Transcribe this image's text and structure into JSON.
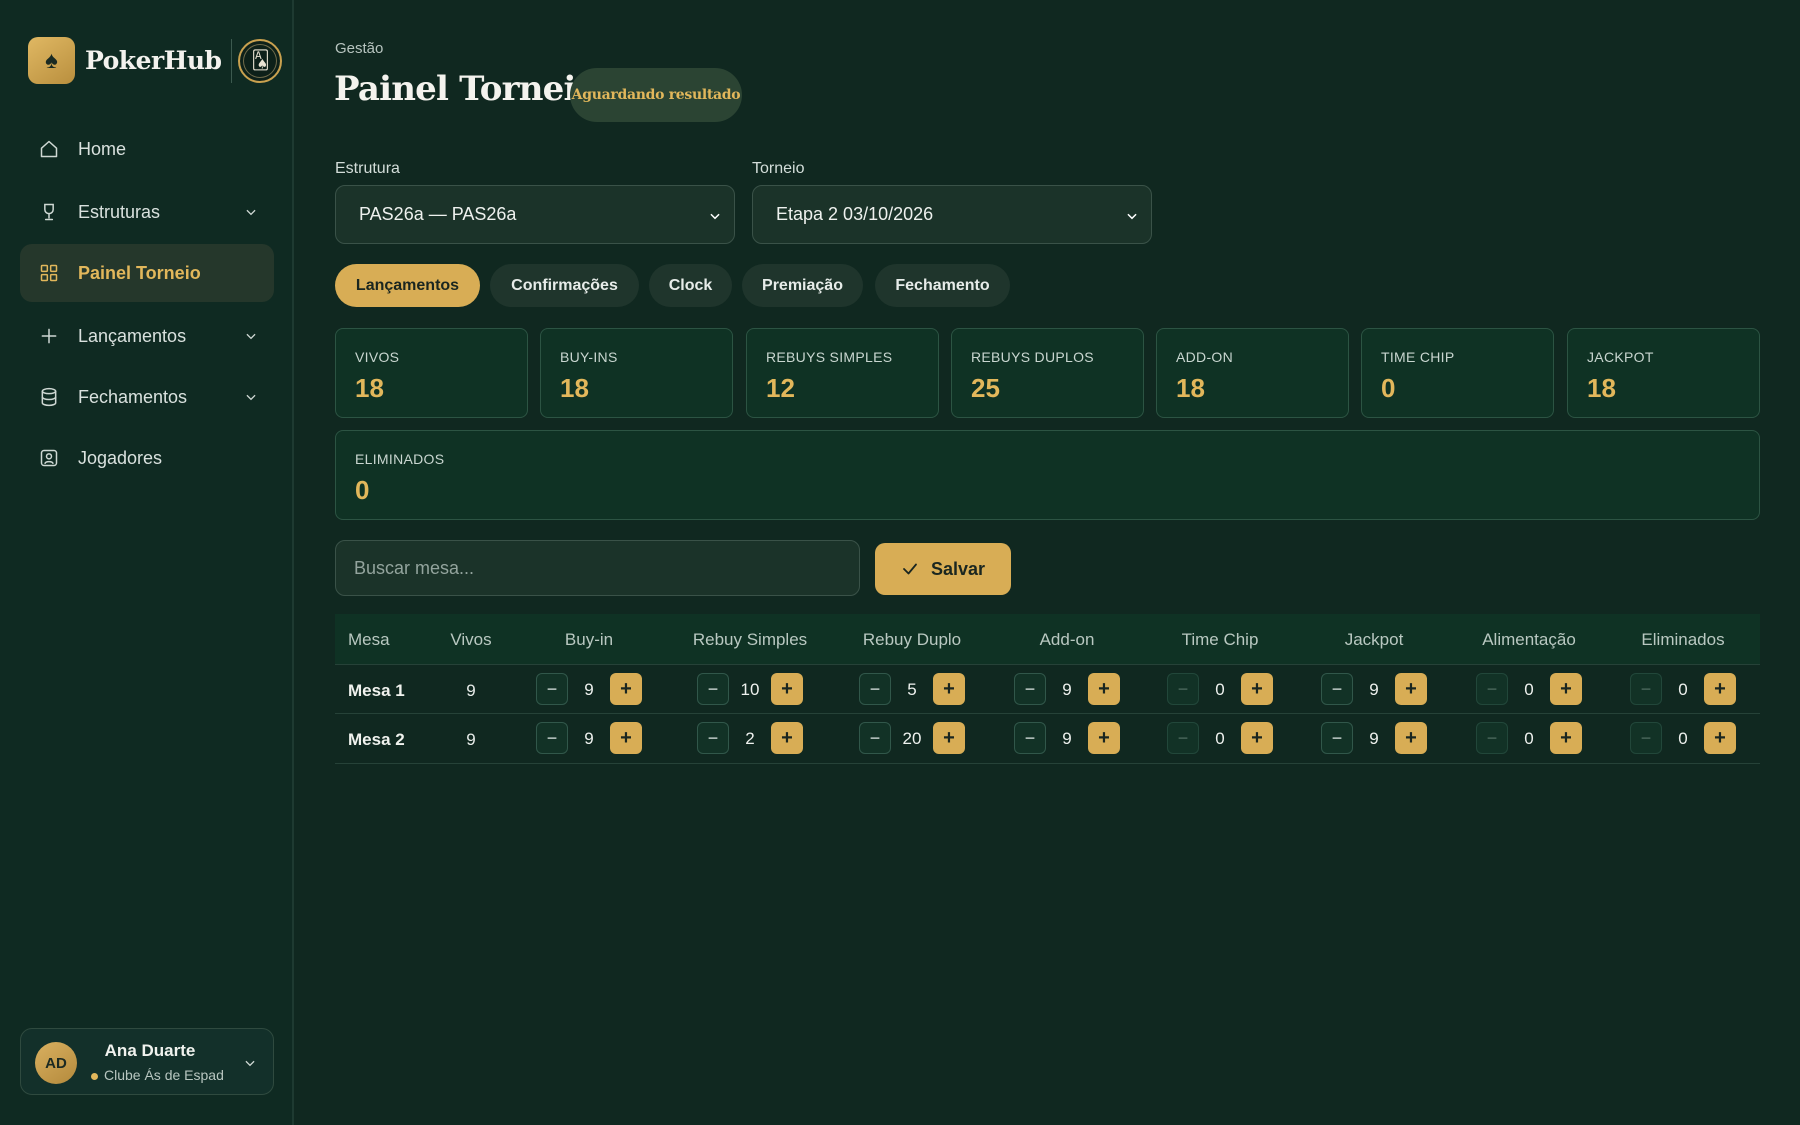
{
  "brand": {
    "name": "PokerHub",
    "logo_icon": "spade-icon",
    "seal_icon": "club-seal-icon"
  },
  "sidebar": {
    "items": [
      {
        "label": "Home",
        "icon": "home-icon",
        "has_chevron": false,
        "active": false
      },
      {
        "label": "Estruturas",
        "icon": "trophy-icon",
        "has_chevron": true,
        "active": false
      },
      {
        "label": "Painel Torneio",
        "icon": "grid-icon",
        "has_chevron": false,
        "active": true
      },
      {
        "label": "Lançamentos",
        "icon": "plus-icon",
        "has_chevron": true,
        "active": false
      },
      {
        "label": "Fechamentos",
        "icon": "database-icon",
        "has_chevron": true,
        "active": false
      },
      {
        "label": "Jogadores",
        "icon": "contact-icon",
        "has_chevron": false,
        "active": false
      }
    ],
    "user": {
      "initials": "AD",
      "name": "Ana Duarte",
      "club": "Clube Ás de Espad"
    }
  },
  "header": {
    "breadcrumb": "Gestão",
    "title": "Painel Torneio",
    "status": "Aguardando resultado"
  },
  "filters": {
    "estrutura": {
      "label": "Estrutura",
      "value": "PAS26a — PAS26a"
    },
    "torneio": {
      "label": "Torneio",
      "value": "Etapa 2 03/10/2026"
    }
  },
  "tabs": [
    {
      "label": "Lançamentos",
      "active": true
    },
    {
      "label": "Confirmações",
      "active": false
    },
    {
      "label": "Clock",
      "active": false
    },
    {
      "label": "Premiação",
      "active": false
    },
    {
      "label": "Fechamento",
      "active": false
    }
  ],
  "stats": [
    {
      "label": "VIVOS",
      "value": "18"
    },
    {
      "label": "BUY-INS",
      "value": "18"
    },
    {
      "label": "REBUYS SIMPLES",
      "value": "12"
    },
    {
      "label": "REBUYS DUPLOS",
      "value": "25"
    },
    {
      "label": "ADD-ON",
      "value": "18"
    },
    {
      "label": "TIME CHIP",
      "value": "0"
    },
    {
      "label": "JACKPOT",
      "value": "18"
    }
  ],
  "eliminados": {
    "label": "ELIMINADOS",
    "value": "0"
  },
  "search": {
    "placeholder": "Buscar mesa..."
  },
  "save": {
    "label": "Salvar"
  },
  "table": {
    "columns": [
      "Mesa",
      "Vivos",
      "Buy-in",
      "Rebuy Simples",
      "Rebuy Duplo",
      "Add-on",
      "Time Chip",
      "Jackpot",
      "Alimentação",
      "Eliminados"
    ],
    "rows": [
      {
        "mesa": "Mesa 1",
        "vivos": "9",
        "values": [
          "9",
          "10",
          "5",
          "9",
          "0",
          "9",
          "0",
          "0"
        ]
      },
      {
        "mesa": "Mesa 2",
        "vivos": "9",
        "values": [
          "9",
          "2",
          "20",
          "9",
          "0",
          "9",
          "0",
          "0"
        ]
      }
    ]
  },
  "colors": {
    "accent": "#d8ad55",
    "background": "#102820",
    "sidebar": "#0f2a22",
    "card": "#0f3224"
  }
}
